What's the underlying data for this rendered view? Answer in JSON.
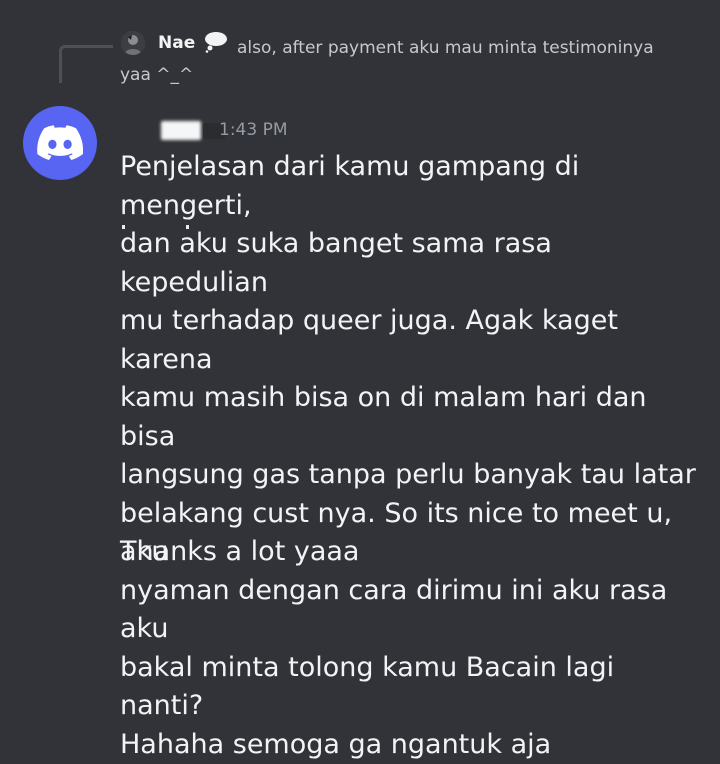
{
  "reply": {
    "author": "Nae",
    "text_line1": "also, after payment aku mau minta testimoninya",
    "text_line2": "yaa ^_^"
  },
  "message": {
    "timestamp": "1:43 PM",
    "lines": [
      "Penjelasan dari kamu gampang di mengerti,",
      "dan aku suka banget sama rasa kepedulian",
      "mu terhadap queer juga. Agak kaget karena",
      "kamu masih bisa on di malam hari dan bisa",
      "langsung gas tanpa perlu banyak tau latar",
      "belakang cust nya. So its nice to meet u, aku",
      "nyaman dengan cara dirimu ini aku rasa aku",
      "bakal minta tolong kamu Bacain lagi nanti?",
      "Hahaha semoga ga ngantuk aja"
    ],
    "followup": "Thanks a lot yaaa"
  },
  "icons": {
    "avatar": "discord-logo-icon",
    "reply_avatar": "user-avatar-icon",
    "badge": "thought-bubble-icon"
  },
  "colors": {
    "background": "#313338",
    "blurple": "#5865f2",
    "text": "#f2f3f5",
    "muted": "#949ba4"
  }
}
